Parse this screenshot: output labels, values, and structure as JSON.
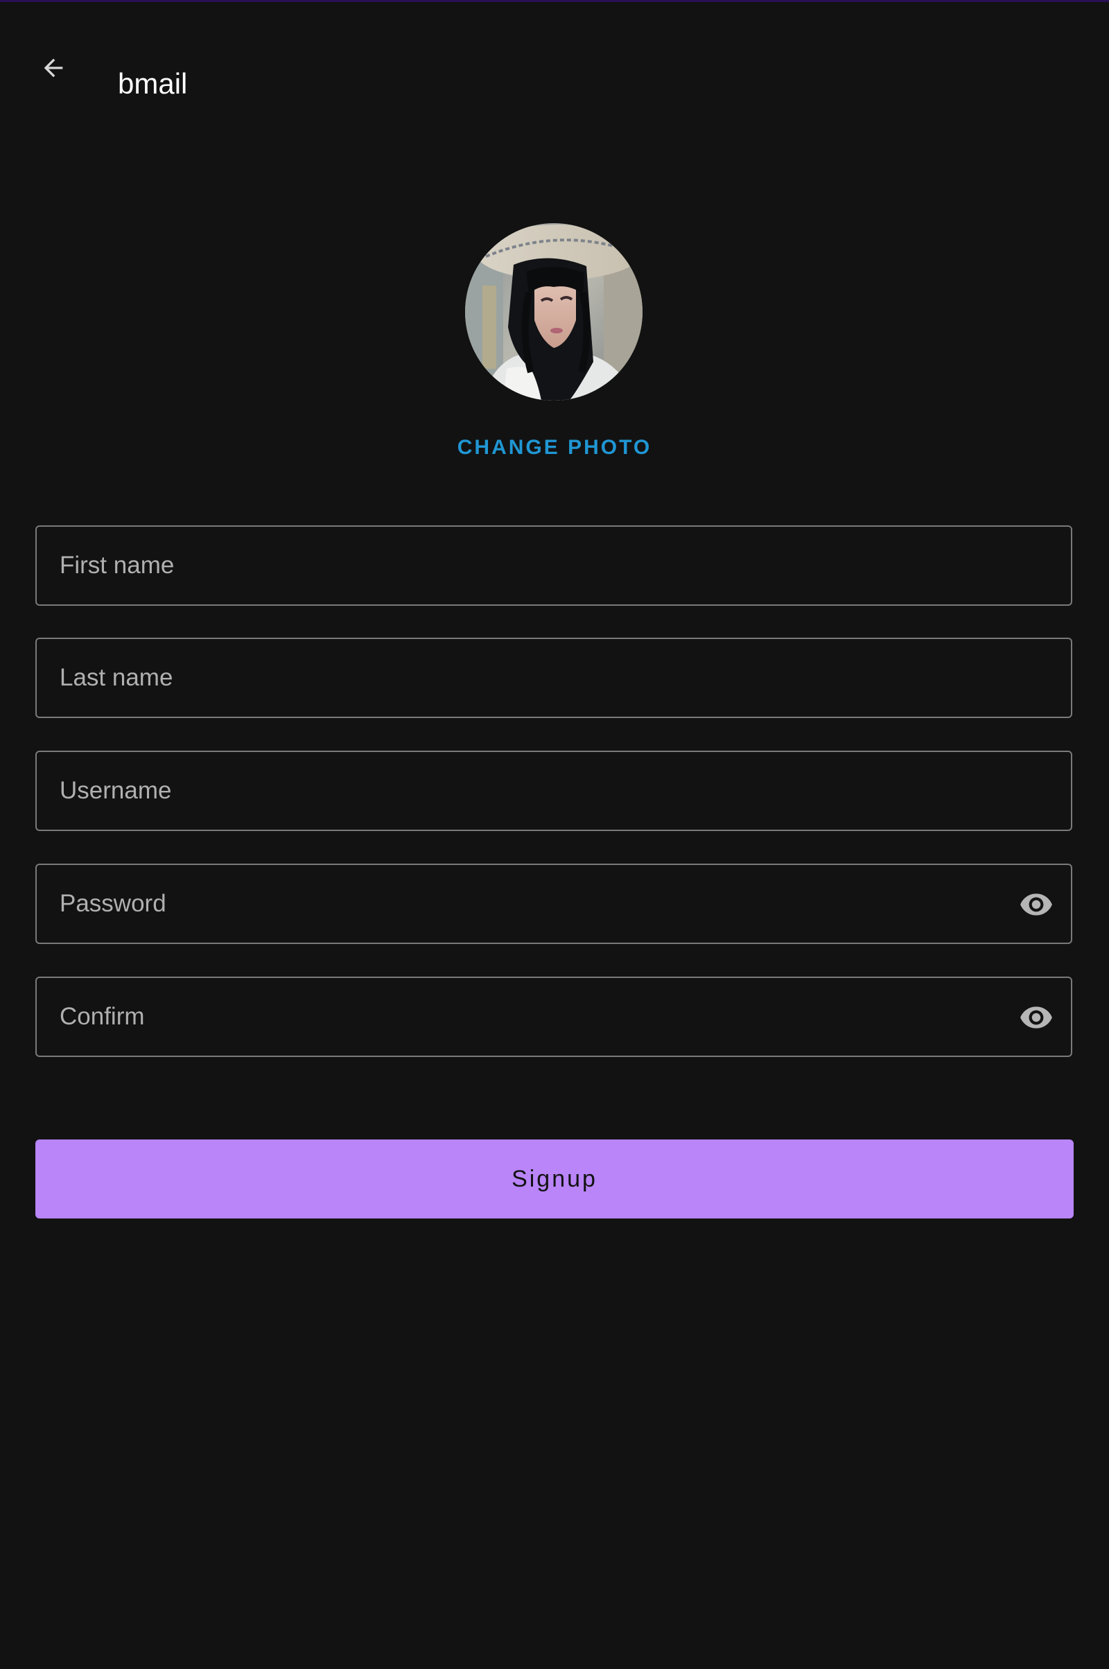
{
  "app_bar": {
    "title": "bmail",
    "back_icon": "arrow-back-icon"
  },
  "profile": {
    "avatar_alt": "profile photo",
    "change_photo_label": "CHANGE PHOTO"
  },
  "form": {
    "first_name": {
      "placeholder": "First name",
      "value": ""
    },
    "last_name": {
      "placeholder": "Last name",
      "value": ""
    },
    "username": {
      "placeholder": "Username",
      "value": ""
    },
    "password": {
      "placeholder": "Password",
      "value": "",
      "toggle_icon": "eye-icon"
    },
    "confirm": {
      "placeholder": "Confirm",
      "value": "",
      "toggle_icon": "eye-icon"
    }
  },
  "signup_button": {
    "label": "Signup"
  },
  "colors": {
    "background": "#121212",
    "accent_button": "#b985f9",
    "link": "#2096d3",
    "field_border": "#7a7a7a",
    "placeholder": "#b0b0b0",
    "top_strip": "#2a0f55"
  }
}
